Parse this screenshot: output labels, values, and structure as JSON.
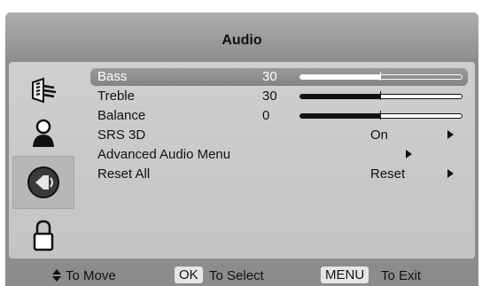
{
  "menu": {
    "title": "Audio"
  },
  "sidebar": {
    "items": [
      {
        "icon": "picture-icon"
      },
      {
        "icon": "user-icon"
      },
      {
        "icon": "speaker-icon",
        "selected": true
      },
      {
        "icon": "lock-icon"
      }
    ]
  },
  "audio": {
    "bass": {
      "label": "Bass",
      "value": "30",
      "level": 0.5
    },
    "treble": {
      "label": "Treble",
      "value": "30",
      "level": 0.5
    },
    "balance": {
      "label": "Balance",
      "value": "0",
      "level": 0.5
    },
    "srs3d": {
      "label": "SRS 3D",
      "option": "On"
    },
    "advanced": {
      "label": "Advanced Audio Menu"
    },
    "reset": {
      "label": "Reset All",
      "option": "Reset"
    }
  },
  "footer": {
    "move": "To Move",
    "ok_key": "OK",
    "select": "To Select",
    "menu_key": "MENU",
    "exit": "To Exit"
  },
  "colors": {
    "panel": "#c8c8c8",
    "highlight": "#8e8e8e",
    "frame": "#8c8c8c"
  }
}
